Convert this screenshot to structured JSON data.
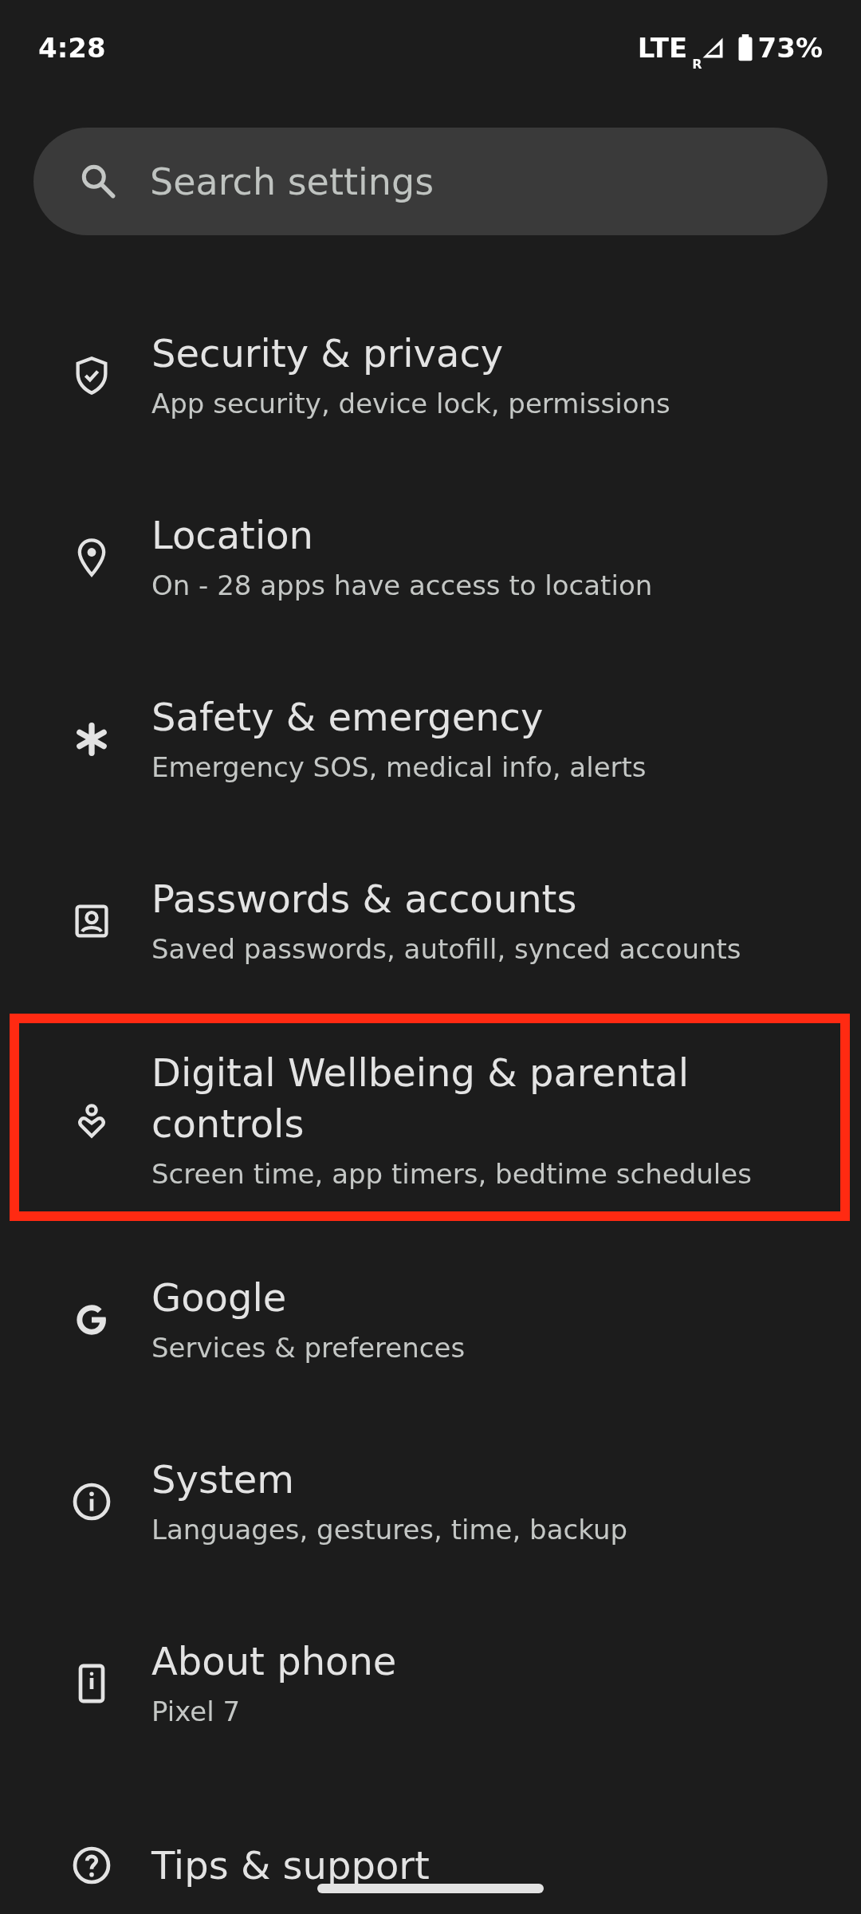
{
  "status_bar": {
    "time": "4:28",
    "network": "LTE",
    "roaming": "R",
    "battery": "73%"
  },
  "search": {
    "placeholder": "Search settings"
  },
  "items": [
    {
      "kind": "shield",
      "title": "Security & privacy",
      "subtitle": "App security, device lock, permissions",
      "highlighted": false
    },
    {
      "kind": "pin",
      "title": "Location",
      "subtitle": "On - 28 apps have access to location",
      "highlighted": false
    },
    {
      "kind": "asterisk",
      "title": "Safety & emergency",
      "subtitle": "Emergency SOS, medical info, alerts",
      "highlighted": false
    },
    {
      "kind": "person",
      "title": "Passwords & accounts",
      "subtitle": "Saved passwords, autofill, synced accounts",
      "highlighted": false
    },
    {
      "kind": "wellbeing",
      "title": "Digital Wellbeing & parental controls",
      "subtitle": "Screen time, app timers, bedtime schedules",
      "highlighted": true
    },
    {
      "kind": "google",
      "title": "Google",
      "subtitle": "Services & preferences",
      "highlighted": false
    },
    {
      "kind": "info",
      "title": "System",
      "subtitle": "Languages, gestures, time, backup",
      "highlighted": false
    },
    {
      "kind": "phone",
      "title": "About phone",
      "subtitle": "Pixel 7",
      "highlighted": false
    },
    {
      "kind": "help",
      "title": "Tips & support",
      "highlighted": false
    }
  ]
}
